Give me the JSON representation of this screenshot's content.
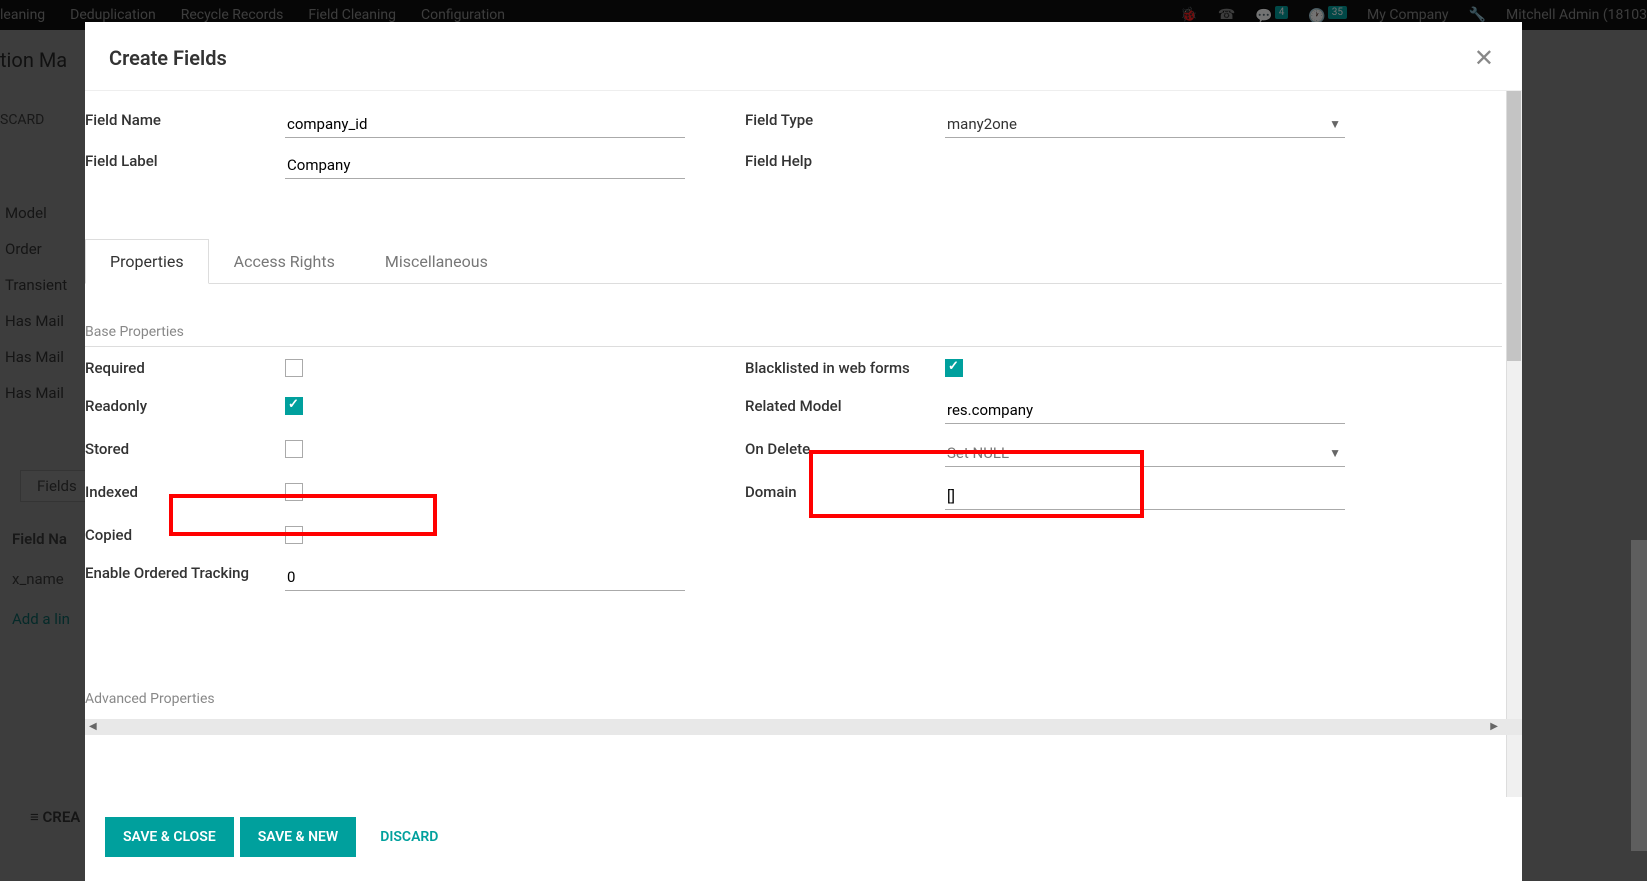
{
  "bg_nav": {
    "left": [
      "leaning",
      "Deduplication",
      "Recycle Records",
      "Field Cleaning",
      "Configuration"
    ],
    "msg_count": "4",
    "clock_count": "35",
    "company": "My Company",
    "user": "Mitchell Admin (18103"
  },
  "bg_page": {
    "breadcrumb": "tion Ma",
    "discard": "SCARD",
    "sidebar": [
      "Model",
      "Order",
      "Transient",
      "Has Mail",
      "Has Mail",
      "Has Mail"
    ],
    "fields_tab": "Fields",
    "field_name_header": "Field Na",
    "xname": "x_name",
    "add_line": "Add a lin",
    "create": "CREA"
  },
  "modal": {
    "title": "Create Fields",
    "top_form": {
      "field_name_label": "Field Name",
      "field_name_value": "company_id",
      "field_label_label": "Field Label",
      "field_label_value": "Company",
      "field_type_label": "Field Type",
      "field_type_value": "many2one",
      "field_help_label": "Field Help"
    },
    "tabs": [
      "Properties",
      "Access Rights",
      "Miscellaneous"
    ],
    "section_base": "Base Properties",
    "section_advanced": "Advanced Properties",
    "props_left": {
      "required": "Required",
      "readonly": "Readonly",
      "stored": "Stored",
      "indexed": "Indexed",
      "copied": "Copied",
      "tracking_label": "Enable Ordered Tracking",
      "tracking_value": "0"
    },
    "props_right": {
      "blacklisted": "Blacklisted in web forms",
      "related_model_label": "Related Model",
      "related_model_value": "res.company",
      "on_delete_label": "On Delete",
      "on_delete_value": "Set NULL",
      "domain_label": "Domain",
      "domain_value": "[]"
    },
    "footer": {
      "save_close": "SAVE & CLOSE",
      "save_new": "SAVE & NEW",
      "discard": "DISCARD"
    }
  }
}
